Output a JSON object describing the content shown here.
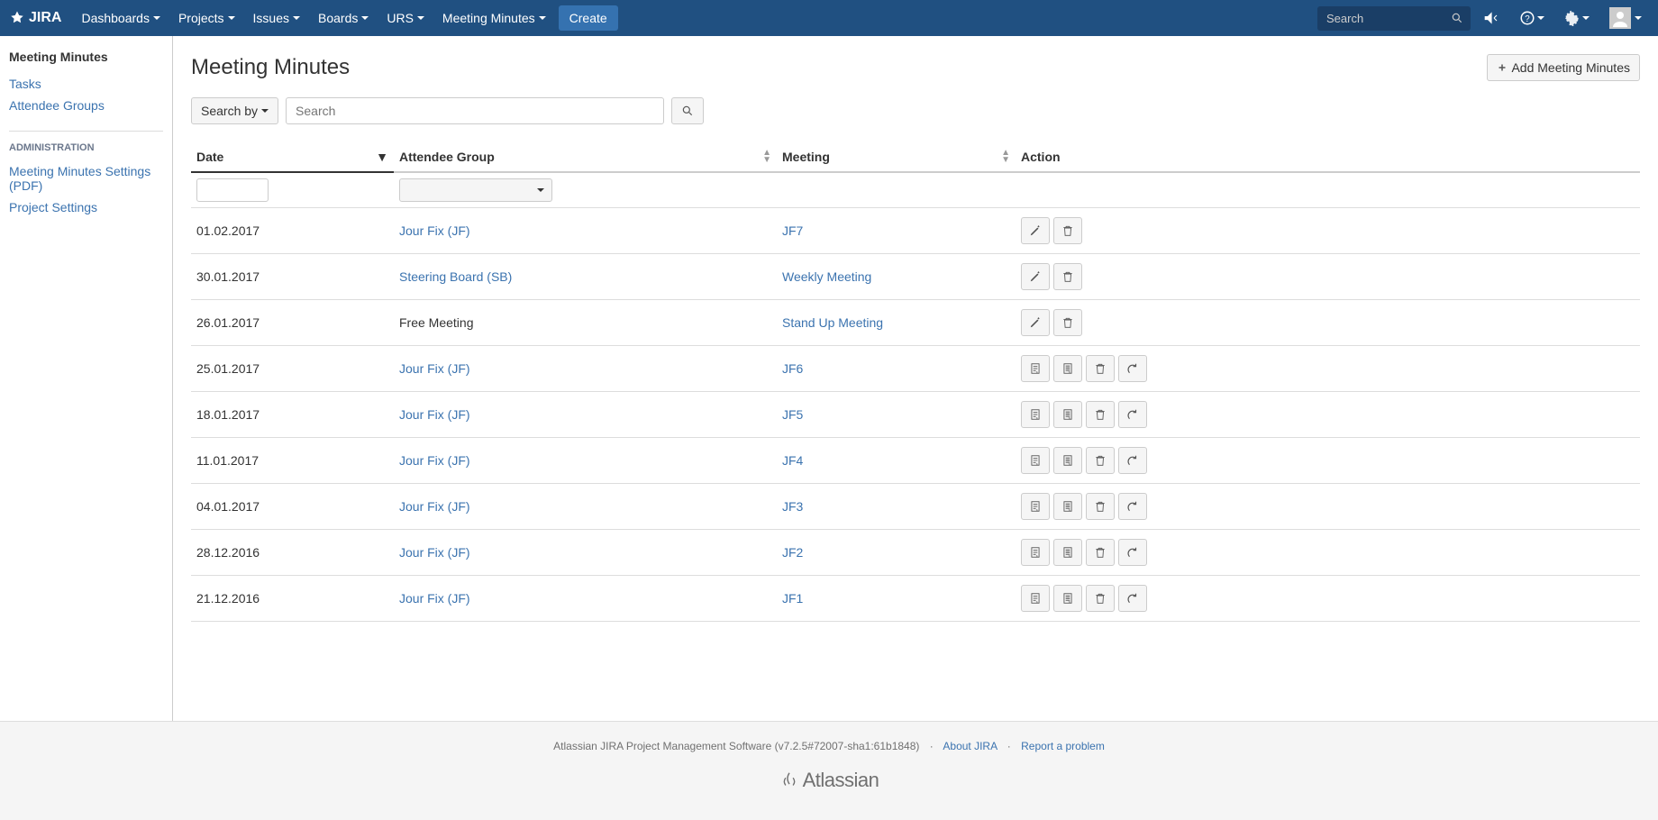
{
  "topnav": {
    "logo": "JIRA",
    "items": [
      "Dashboards",
      "Projects",
      "Issues",
      "Boards",
      "URS",
      "Meeting Minutes"
    ],
    "create": "Create",
    "search_placeholder": "Search"
  },
  "sidebar": {
    "title": "Meeting Minutes",
    "items": [
      {
        "label": "Tasks"
      },
      {
        "label": "Attendee Groups"
      }
    ],
    "admin_header": "ADMINISTRATION",
    "admin_items": [
      {
        "label": "Meeting Minutes Settings (PDF)"
      },
      {
        "label": "Project Settings"
      }
    ]
  },
  "page": {
    "title": "Meeting Minutes",
    "add_button": "Add Meeting Minutes",
    "search_by": "Search by",
    "search_placeholder": "Search"
  },
  "table": {
    "headers": {
      "date": "Date",
      "attendee_group": "Attendee Group",
      "meeting": "Meeting",
      "action": "Action"
    },
    "rows": [
      {
        "date": "01.02.2017",
        "group": "Jour Fix (JF)",
        "group_link": true,
        "meeting": "JF7",
        "actions": "edit"
      },
      {
        "date": "30.01.2017",
        "group": "Steering Board (SB)",
        "group_link": true,
        "meeting": "Weekly Meeting",
        "actions": "edit"
      },
      {
        "date": "26.01.2017",
        "group": "Free Meeting",
        "group_link": false,
        "meeting": "Stand Up Meeting",
        "actions": "edit"
      },
      {
        "date": "25.01.2017",
        "group": "Jour Fix (JF)",
        "group_link": true,
        "meeting": "JF6",
        "actions": "doc"
      },
      {
        "date": "18.01.2017",
        "group": "Jour Fix (JF)",
        "group_link": true,
        "meeting": "JF5",
        "actions": "doc"
      },
      {
        "date": "11.01.2017",
        "group": "Jour Fix (JF)",
        "group_link": true,
        "meeting": "JF4",
        "actions": "doc"
      },
      {
        "date": "04.01.2017",
        "group": "Jour Fix (JF)",
        "group_link": true,
        "meeting": "JF3",
        "actions": "doc"
      },
      {
        "date": "28.12.2016",
        "group": "Jour Fix (JF)",
        "group_link": true,
        "meeting": "JF2",
        "actions": "doc"
      },
      {
        "date": "21.12.2016",
        "group": "Jour Fix (JF)",
        "group_link": true,
        "meeting": "JF1",
        "actions": "doc"
      }
    ]
  },
  "footer": {
    "text": "Atlassian JIRA Project Management Software (v7.2.5#72007-sha1:61b1848)",
    "about": "About JIRA",
    "report": "Report a problem",
    "brand": "Atlassian"
  }
}
